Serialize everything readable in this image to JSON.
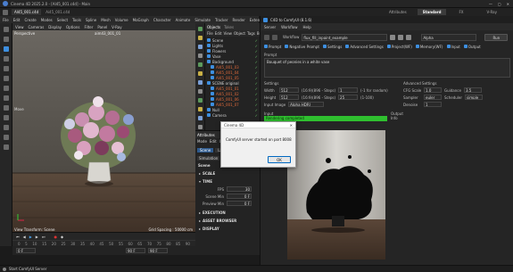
{
  "titlebar": {
    "app_title": "Cinema 4D 2025.2.0 - [AI45_001.c4d] - Main"
  },
  "doc_tabs": {
    "active": "AI45_001.c4d",
    "extra": "Ai45_001.c4d"
  },
  "top_tabs": {
    "items": [
      "Attributes",
      "Standard",
      "FX",
      "V-Ray"
    ],
    "active": "Standard"
  },
  "menubar": {
    "items": [
      "File",
      "Edit",
      "Create",
      "Modes",
      "Select",
      "Tools",
      "Spline",
      "Mesh",
      "Volume",
      "MoGraph",
      "Character",
      "Animate",
      "Simulate",
      "Tracker",
      "Render",
      "Extensions",
      "Window",
      "Help"
    ]
  },
  "viewport": {
    "menu": [
      "View",
      "Cameras",
      "Display",
      "Options",
      "Filter",
      "Panel",
      "V-Ray"
    ],
    "label": "Perspective",
    "camera": "aim43_001_01",
    "move_label": "Move",
    "bottom_left": "View Transform: Scene",
    "bottom_right": "Grid Spacing : 50000 cm"
  },
  "objects": {
    "tabs": [
      "Objects",
      "Takes"
    ],
    "menu": [
      "File",
      "Edit",
      "View",
      "Object",
      "Tags",
      "Bookmarks"
    ],
    "items": [
      {
        "name": "Scene",
        "color": "#d0d0d0"
      },
      {
        "name": "Lights",
        "color": "#d0d0d0"
      },
      {
        "name": "Flowers",
        "color": "#d0d0d0"
      },
      {
        "name": "Vase",
        "color": "#d0d0d0"
      },
      {
        "name": "Background",
        "color": "#d0d0d0"
      },
      {
        "name": "AI45_001_03",
        "color": "#e06a3a"
      },
      {
        "name": "AI45_001_04",
        "color": "#e06a3a"
      },
      {
        "name": "AI45_001_05",
        "color": "#e06a3a"
      },
      {
        "name": "SCENE original",
        "color": "#d0d0d0"
      },
      {
        "name": "AI45_001_01",
        "color": "#e06a3a"
      },
      {
        "name": "AI45_001_02",
        "color": "#e06a3a"
      },
      {
        "name": "AI45_001_06",
        "color": "#e06a3a"
      },
      {
        "name": "AI45_001_07",
        "color": "#e06a3a"
      },
      {
        "name": "Null",
        "color": "#d0d0d0"
      },
      {
        "name": "Camera",
        "color": "#d0d0d0"
      }
    ]
  },
  "attributes": {
    "title": "Attributes",
    "tabs": [
      "Mode",
      "Edit",
      "User Data"
    ],
    "subtabs": [
      "Scene",
      "Layers",
      "Take"
    ],
    "subtabs2": [
      "Simulation",
      "To Do",
      "Nodes"
    ],
    "active_subtab": "Scene",
    "heading": "Scene",
    "sections": {
      "scale": "SCALE",
      "time": "TIME",
      "execution": "EXECUTION",
      "asset_browser": "ASSET BROWSER",
      "display": "DISPLAY"
    },
    "fields": [
      {
        "label": "FPS",
        "value": "30"
      },
      {
        "label": "Scene Min",
        "value": "0 F"
      },
      {
        "label": "Preview Min",
        "value": "0 F"
      }
    ]
  },
  "timeline": {
    "start": "0 F",
    "end": "90 F",
    "current": "0 F",
    "max": "90 F",
    "ticks": [
      "0",
      "5",
      "10",
      "15",
      "20",
      "25",
      "30",
      "35",
      "40",
      "45",
      "50",
      "55",
      "60",
      "65",
      "70",
      "75",
      "80",
      "85",
      "90"
    ]
  },
  "status": {
    "text": "Start ComfyUI Server"
  },
  "comfy": {
    "window_title": "C4D to ComfyUI (8.1.6)",
    "menu": [
      "Server",
      "Workflow",
      "Help"
    ],
    "workflow_label": "Workflow",
    "workflow_value": "flux_fill_inpaint_example",
    "alpha_value": "Alpha",
    "run_label": "Run",
    "checks": [
      "Prompt",
      "Negative Prompt",
      "Settings",
      "Advanced Settings",
      "Project(WF)",
      "Memory(WF)",
      "Input",
      "Output"
    ],
    "prompt_label": "Prompt",
    "prompt_text": "Bouquet of peonies in a white vase",
    "settings_label": "Settings",
    "width_label": "Width",
    "width_value": "512",
    "height_label": "Height",
    "height_value": "512",
    "w_ratio": "(16:9)(896 - Steps)",
    "h_ratio": "(16:9)(896 - Steps)",
    "steps_w": "1",
    "steps_h": "25",
    "random_label": "(-1 for random)",
    "size_label": "(1-100)",
    "input_image_label": "Input Image",
    "input_image_value": "Alpha HDRI",
    "adv_label": "Advanced Settings",
    "cfg_label": "CFG Scale",
    "cfg_value": "1.0",
    "guidance_label": "Guidance",
    "guidance_value": "3.5",
    "sampler_label": "Sampler",
    "sampler_value": "euler",
    "scheduler_label": "Scheduler",
    "scheduler_value": "simple",
    "denoise_label": "Denoise",
    "denoise_value": "1",
    "input_section": "Input",
    "output_section": "Output",
    "progress_text": "Rendering completed",
    "output_text": "Info",
    "status_color": "#2fbf2f"
  },
  "dialog": {
    "title": "Cinema 4D",
    "message": "ComfyUI server started on port 8008",
    "ok": "OK"
  }
}
